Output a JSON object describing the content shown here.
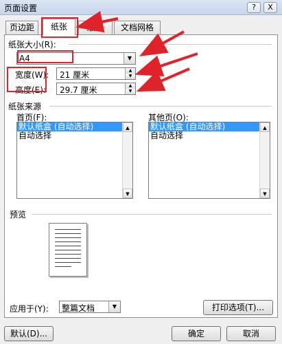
{
  "window": {
    "title": "页面设置",
    "help_btn": "?",
    "close_btn": "X"
  },
  "tabs": [
    {
      "label": "页边距"
    },
    {
      "label": "纸张"
    },
    {
      "label": "版式"
    },
    {
      "label": "文档网格"
    }
  ],
  "paper_size": {
    "label": "纸张大小(R):",
    "value": "A4",
    "width_label": "宽度(W):",
    "width_value": "21 厘米",
    "height_label": "高度(E):",
    "height_value": "29.7 厘米"
  },
  "paper_source": {
    "label": "纸张来源",
    "first_page_label": "首页(F):",
    "other_pages_label": "其他页(O):",
    "first_page_items": [
      "默认纸盒 (自动选择)",
      "自动选择"
    ],
    "other_pages_items": [
      "默认纸盒 (自动选择)",
      "自动选择"
    ]
  },
  "preview": {
    "label": "预览"
  },
  "apply": {
    "label": "应用于(Y):",
    "value": "整篇文档"
  },
  "buttons": {
    "print_options": "打印选项(T)...",
    "default": "默认(D)...",
    "ok": "确定",
    "cancel": "取消"
  },
  "annotation_color": "#e0232a"
}
